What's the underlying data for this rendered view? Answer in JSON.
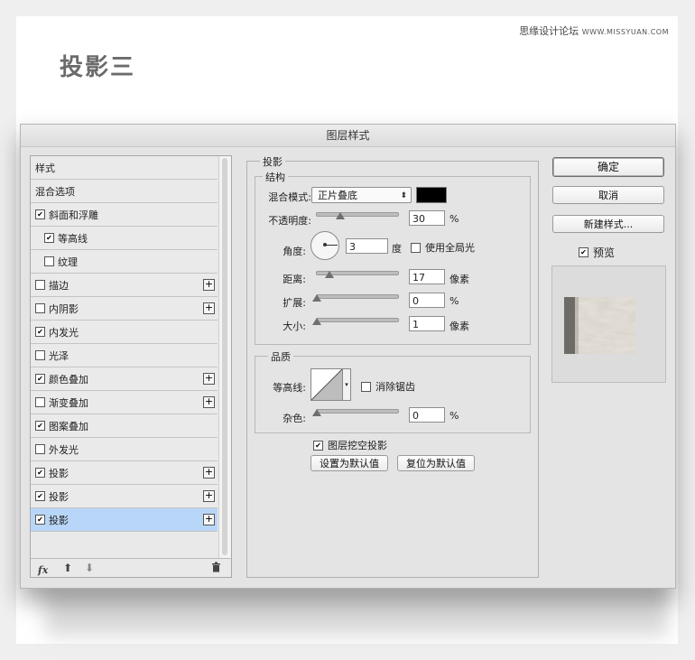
{
  "watermark": {
    "site_name": "思缘设计论坛",
    "site_domain": "WWW.MISSYUAN.COM"
  },
  "page_heading": "投影三",
  "dialog": {
    "title": "图层样式",
    "styles_list": [
      {
        "label": "样式",
        "checkbox": false,
        "checked": false,
        "plus": false,
        "indent": false,
        "selected": false
      },
      {
        "label": "混合选项",
        "checkbox": false,
        "checked": false,
        "plus": false,
        "indent": false,
        "selected": false
      },
      {
        "label": "斜面和浮雕",
        "checkbox": true,
        "checked": true,
        "plus": false,
        "indent": false,
        "selected": false
      },
      {
        "label": "等高线",
        "checkbox": true,
        "checked": true,
        "plus": false,
        "indent": true,
        "selected": false
      },
      {
        "label": "纹理",
        "checkbox": true,
        "checked": false,
        "plus": false,
        "indent": true,
        "selected": false
      },
      {
        "label": "描边",
        "checkbox": true,
        "checked": false,
        "plus": true,
        "indent": false,
        "selected": false
      },
      {
        "label": "内阴影",
        "checkbox": true,
        "checked": false,
        "plus": true,
        "indent": false,
        "selected": false
      },
      {
        "label": "内发光",
        "checkbox": true,
        "checked": true,
        "plus": false,
        "indent": false,
        "selected": false
      },
      {
        "label": "光泽",
        "checkbox": true,
        "checked": false,
        "plus": false,
        "indent": false,
        "selected": false
      },
      {
        "label": "颜色叠加",
        "checkbox": true,
        "checked": true,
        "plus": true,
        "indent": false,
        "selected": false
      },
      {
        "label": "渐变叠加",
        "checkbox": true,
        "checked": false,
        "plus": true,
        "indent": false,
        "selected": false
      },
      {
        "label": "图案叠加",
        "checkbox": true,
        "checked": true,
        "plus": false,
        "indent": false,
        "selected": false
      },
      {
        "label": "外发光",
        "checkbox": true,
        "checked": false,
        "plus": false,
        "indent": false,
        "selected": false
      },
      {
        "label": "投影",
        "checkbox": true,
        "checked": true,
        "plus": true,
        "indent": false,
        "selected": false
      },
      {
        "label": "投影",
        "checkbox": true,
        "checked": true,
        "plus": true,
        "indent": false,
        "selected": false
      },
      {
        "label": "投影",
        "checkbox": true,
        "checked": true,
        "plus": true,
        "indent": false,
        "selected": true
      }
    ],
    "footer": {
      "fx_label": "fx",
      "fx_sub": "."
    },
    "settings": {
      "group_title": "投影",
      "structure": {
        "title": "结构",
        "blend_mode_label": "混合模式:",
        "blend_mode_value": "正片叠底",
        "shadow_color": "#000000",
        "opacity_label": "不透明度:",
        "opacity_value": "30",
        "opacity_unit": "%",
        "opacity_fraction": 0.3,
        "angle_label": "角度:",
        "angle_value": "3",
        "angle_unit": "度",
        "use_global_light_label": "使用全局光",
        "use_global_light": false,
        "distance_label": "距离:",
        "distance_value": "17",
        "distance_unit": "像素",
        "spread_label": "扩展:",
        "spread_value": "0",
        "spread_unit": "%",
        "size_label": "大小:",
        "size_value": "1",
        "size_unit": "像素"
      },
      "quality": {
        "title": "品质",
        "contour_label": "等高线:",
        "anti_alias_label": "消除锯齿",
        "anti_alias": false,
        "noise_label": "杂色:",
        "noise_value": "0",
        "noise_unit": "%"
      },
      "knockout_label": "图层挖空投影",
      "knockout": true,
      "make_default_label": "设置为默认值",
      "reset_default_label": "复位为默认值"
    },
    "buttons": {
      "ok": "确定",
      "cancel": "取消",
      "new_style": "新建样式...",
      "preview_label": "预览",
      "preview_checked": true
    }
  }
}
